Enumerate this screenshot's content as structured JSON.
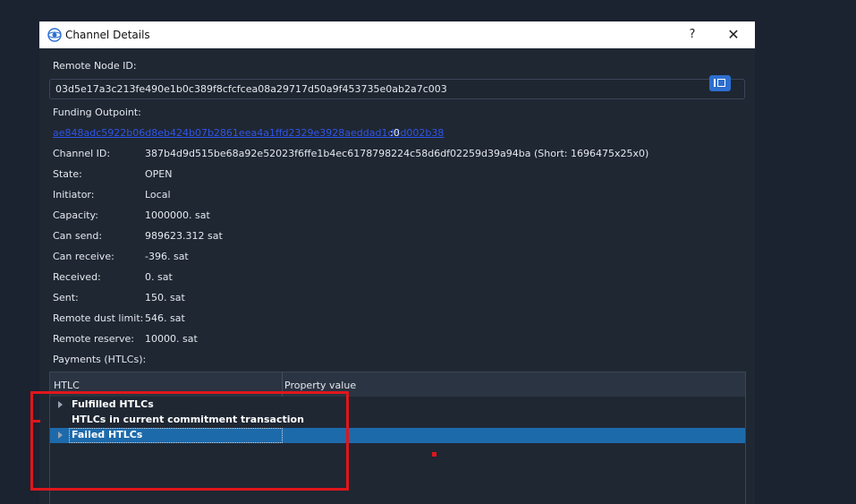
{
  "window": {
    "title": "Channel Details",
    "help_label": "?",
    "close_label": "✕"
  },
  "remote_node": {
    "label": "Remote Node ID:",
    "value": "03d5e17a3c213fe490e1b0c389f8cfcfcea08a29717d50a9f453735e0ab2a7c003",
    "copy_icon": "copy-icon"
  },
  "funding": {
    "label": "Funding Outpoint:",
    "link_text": "ae848adc5922b06d8eb424b07b2861eea4a1ffd2329e3928aeddad1d8d002b38",
    "suffix": ":0"
  },
  "details": [
    {
      "label": "Channel ID:",
      "value": "387b4d9d515be68a92e52023f6ffe1b4ec6178798224c58d6df02259d39a94ba (Short: 1696475x25x0)"
    },
    {
      "label": "State:",
      "value": "OPEN"
    },
    {
      "label": "Initiator:",
      "value": "Local"
    },
    {
      "label": "Capacity:",
      "value": "1000000. sat"
    },
    {
      "label": "Can send:",
      "value": "989623.312 sat"
    },
    {
      "label": "Can receive:",
      "value": "-396. sat"
    },
    {
      "label": "Received:",
      "value": "0. sat"
    },
    {
      "label": "Sent:",
      "value": "150. sat"
    },
    {
      "label": "Remote dust limit:",
      "value": "546. sat"
    },
    {
      "label": "Remote reserve:",
      "value": "10000. sat"
    }
  ],
  "payments": {
    "label": "Payments (HTLCs):",
    "columns": [
      "HTLC",
      "Property value"
    ],
    "rows": [
      {
        "label": "Fulfilled HTLCs",
        "expandable": true,
        "selected": false
      },
      {
        "label": "HTLCs in current commitment transaction",
        "expandable": false,
        "selected": false
      },
      {
        "label": "Failed HTLCs",
        "expandable": true,
        "selected": true
      }
    ]
  },
  "colors": {
    "background": "#1b2230",
    "dialog": "#1f2733",
    "selection": "#1d6aab",
    "link": "#2f55e8",
    "annotation": "#e0161c"
  }
}
